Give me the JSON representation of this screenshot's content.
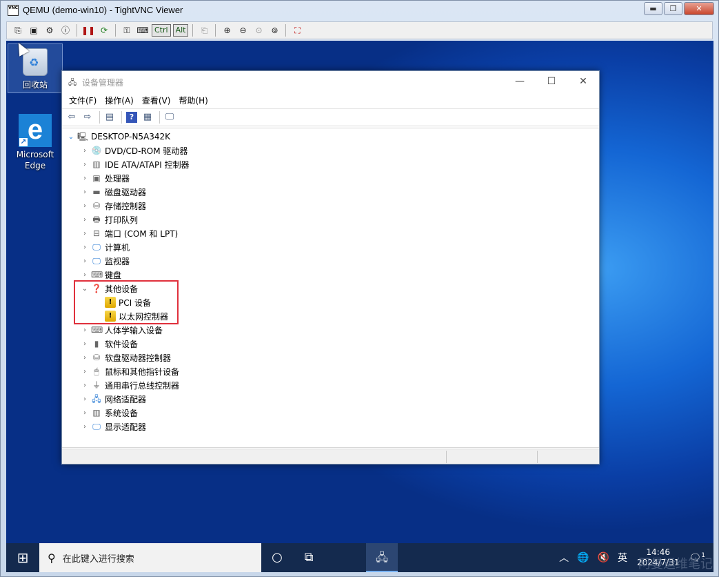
{
  "vnc": {
    "title": "QEMU (demo-win10) - TightVNC Viewer",
    "logo_text": "VNC",
    "min_icon": "minimize-icon",
    "max_icon": "maximize-icon",
    "close_icon": "close-icon",
    "toolbar": {
      "ctrl_label": "Ctrl",
      "alt_label": "Alt",
      "icons": [
        "new-connection-icon",
        "save-icon",
        "options-icon",
        "info-icon",
        "pause-icon",
        "refresh-icon",
        "key-icon",
        "ctrl-alt-del-icon",
        "clipboard-icon",
        "zoom-in-icon",
        "zoom-out-icon",
        "zoom-100-icon",
        "zoom-fit-icon",
        "fullscreen-icon"
      ]
    }
  },
  "desktop": {
    "recycle_bin": "回收站",
    "edge_label": "Microsoft Edge"
  },
  "devmgr": {
    "title": "设备管理器",
    "menu": [
      "文件(F)",
      "操作(A)",
      "查看(V)",
      "帮助(H)"
    ],
    "tools": [
      "back-icon",
      "forward-icon",
      "properties-icon",
      "help-icon",
      "view-icon",
      "monitor-icon"
    ],
    "root": "DESKTOP-N5A342K",
    "categories": [
      {
        "label": "DVD/CD-ROM 驱动器",
        "icon": "dvd-icon",
        "expanded": false
      },
      {
        "label": "IDE ATA/ATAPI 控制器",
        "icon": "ide-controller-icon",
        "expanded": false
      },
      {
        "label": "处理器",
        "icon": "processor-icon",
        "expanded": false
      },
      {
        "label": "磁盘驱动器",
        "icon": "disk-icon",
        "expanded": false
      },
      {
        "label": "存储控制器",
        "icon": "storage-controller-icon",
        "expanded": false
      },
      {
        "label": "打印队列",
        "icon": "printer-icon",
        "expanded": false
      },
      {
        "label": "端口 (COM 和 LPT)",
        "icon": "port-icon",
        "expanded": false
      },
      {
        "label": "计算机",
        "icon": "computer-icon",
        "expanded": false
      },
      {
        "label": "监视器",
        "icon": "monitor-icon",
        "expanded": false
      },
      {
        "label": "键盘",
        "icon": "keyboard-icon",
        "expanded": false
      },
      {
        "label": "其他设备",
        "icon": "unknown-device-icon",
        "expanded": true,
        "children": [
          {
            "label": "PCI 设备",
            "icon": "warning-device-icon"
          },
          {
            "label": "以太网控制器",
            "icon": "warning-device-icon"
          }
        ]
      },
      {
        "label": "人体学输入设备",
        "icon": "hid-icon",
        "expanded": false
      },
      {
        "label": "软件设备",
        "icon": "software-device-icon",
        "expanded": false
      },
      {
        "label": "软盘驱动器控制器",
        "icon": "floppy-controller-icon",
        "expanded": false
      },
      {
        "label": "鼠标和其他指针设备",
        "icon": "mouse-icon",
        "expanded": false
      },
      {
        "label": "通用串行总线控制器",
        "icon": "usb-icon",
        "expanded": false
      },
      {
        "label": "网络适配器",
        "icon": "network-adapter-icon",
        "expanded": false
      },
      {
        "label": "系统设备",
        "icon": "system-device-icon",
        "expanded": false
      },
      {
        "label": "显示适配器",
        "icon": "display-adapter-icon",
        "expanded": false
      }
    ]
  },
  "taskbar": {
    "search_placeholder": "在此键入进行搜索",
    "ime": "英",
    "time": "14:46",
    "date": "2024/7/31",
    "notification_count": "1"
  },
  "watermark": "阿曼运维笔记",
  "colors": {
    "highlight_border": "#e0303c",
    "desktop_blue": "#1466d4",
    "taskbar": "#142a4e"
  }
}
